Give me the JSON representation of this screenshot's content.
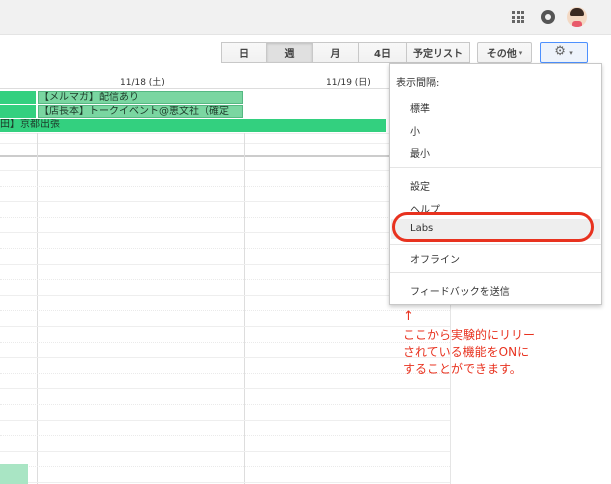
{
  "toolbar": {
    "day": "日",
    "week": "週",
    "month": "月",
    "four_days": "4日",
    "agenda": "予定リスト",
    "more": "その他",
    "more_caret": "▾",
    "settings_caret": "▾"
  },
  "calendar": {
    "days": [
      "11/18 (土)",
      "11/19 (日)"
    ],
    "events": [
      {
        "label": "【メルマガ】配信あり"
      },
      {
        "label": "【店長本】トークイベント@恵文社（確定"
      },
      {
        "label": "田】京都出張"
      }
    ]
  },
  "menu": {
    "header": "表示間隔:",
    "density_options": [
      "標準",
      "小",
      "最小"
    ],
    "items": [
      "設定",
      "ヘルプ",
      "Labs",
      "オフライン",
      "フィードバックを送信"
    ]
  },
  "annotation": {
    "arrow": "↑",
    "lines": [
      "ここから実験的にリリー",
      "されている機能をONに",
      "することができます。"
    ]
  }
}
